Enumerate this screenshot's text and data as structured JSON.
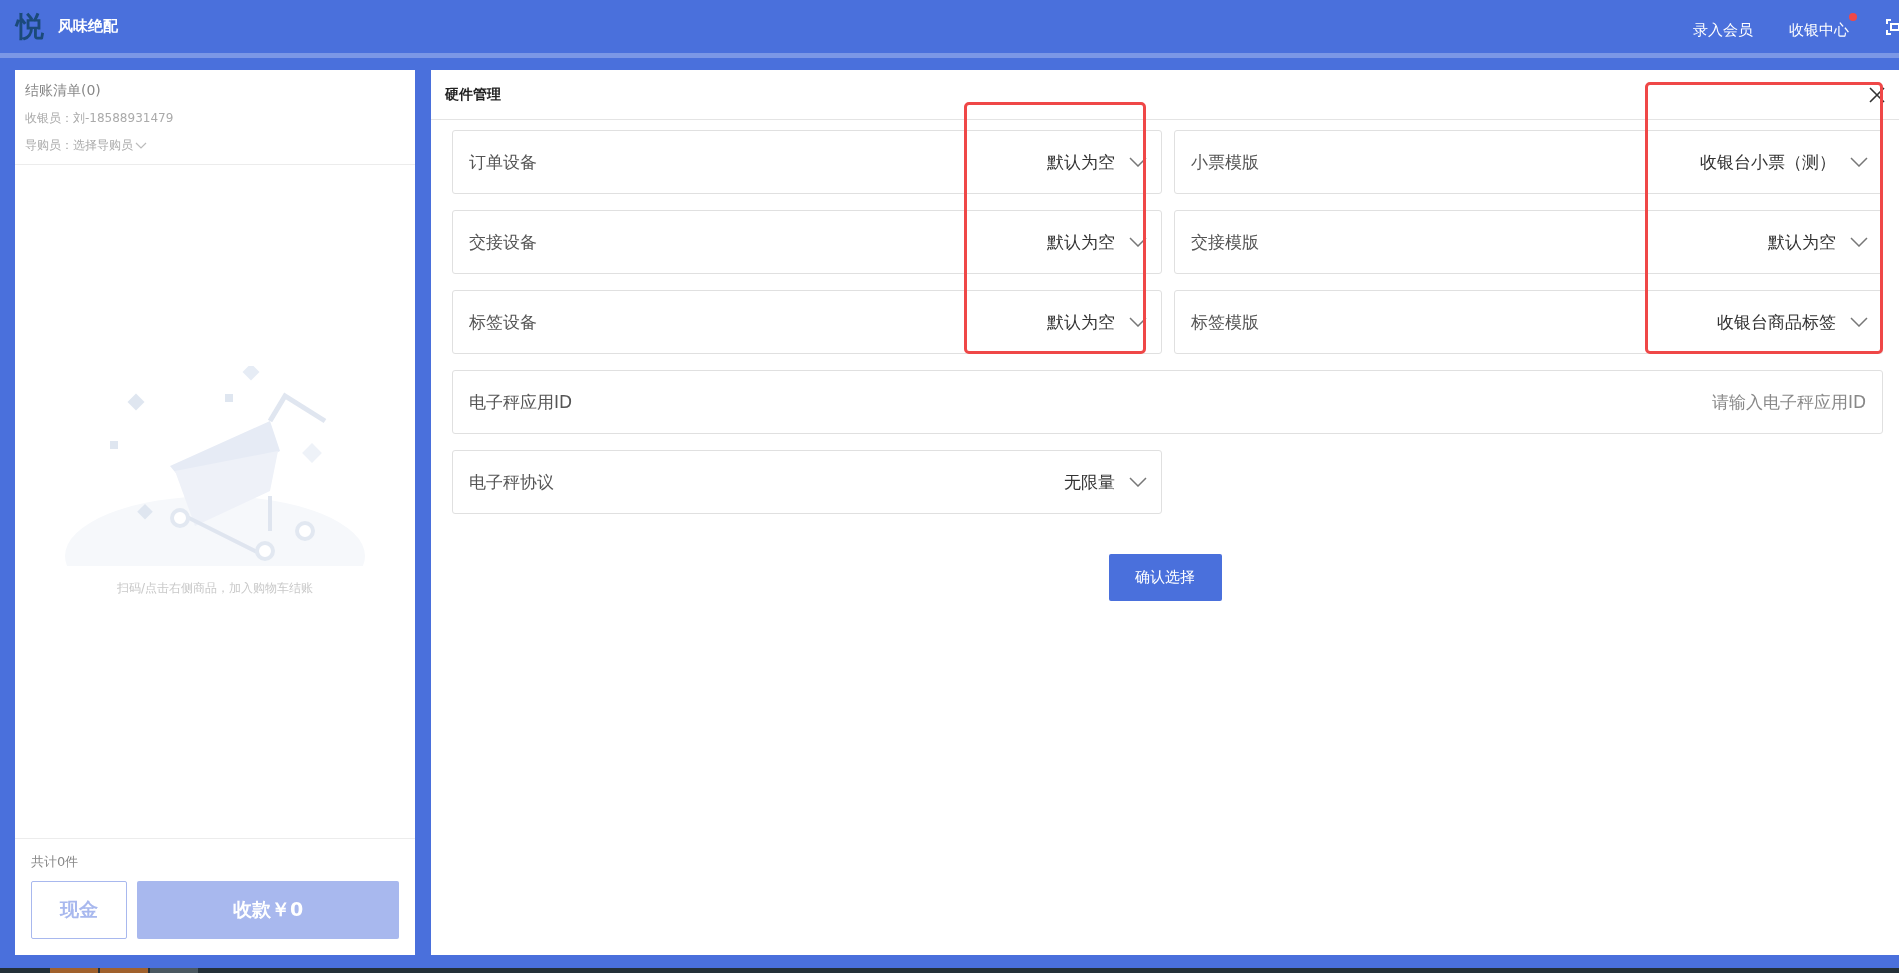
{
  "header": {
    "logo": "悦",
    "brand": "风味绝配",
    "links": [
      {
        "label": "录入会员",
        "notify": false
      },
      {
        "label": "收银中心",
        "notify": true
      }
    ]
  },
  "cart": {
    "title": "结账清单(0)",
    "cashier": "收银员：刘-18588931479",
    "guide_label": "导购员：",
    "guide_value": "选择导购员",
    "empty_hint": "扫码/点击右侧商品，加入购物车结账",
    "total": "共计0件",
    "cash_button": "现金",
    "pay_button": "收款￥0",
    "pay_disabled": true
  },
  "dialog": {
    "title": "硬件管理",
    "fields": [
      {
        "kind": "select",
        "label": "订单设备",
        "value": "默认为空"
      },
      {
        "kind": "select",
        "label": "小票模版",
        "value": "收银台小票（测）"
      },
      {
        "kind": "select",
        "label": "交接设备",
        "value": "默认为空"
      },
      {
        "kind": "select",
        "label": "交接模版",
        "value": "默认为空"
      },
      {
        "kind": "select",
        "label": "标签设备",
        "value": "默认为空"
      },
      {
        "kind": "select",
        "label": "标签模版",
        "value": "收银台商品标签"
      },
      {
        "kind": "input",
        "label": "电子秤应用ID",
        "placeholder": "请输入电子秤应用ID"
      },
      {
        "kind": "select",
        "label": "电子秤协议",
        "value": "无限量"
      }
    ],
    "confirm_button": "确认选择"
  }
}
